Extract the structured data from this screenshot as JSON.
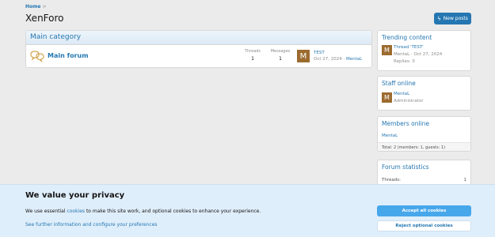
{
  "breadcrumb": {
    "home": "Home",
    "separator": ">"
  },
  "page": {
    "title": "XenForo",
    "new_posts_label": "New posts"
  },
  "category": {
    "title": "Main category"
  },
  "forum": {
    "name": "Main forum",
    "threads_label": "Threads",
    "threads_value": "1",
    "messages_label": "Messages",
    "messages_value": "1",
    "last_post": {
      "avatar_letter": "M",
      "title": "TEST",
      "date": "Oct 27, 2024",
      "meta_sep": "·",
      "user": "MentaL"
    }
  },
  "sidebar": {
    "trending": {
      "title": "Trending content",
      "avatar_letter": "M",
      "thread_title": "Thread 'TEST'",
      "meta": "MentaL · Oct 27, 2024",
      "replies": "Replies: 0"
    },
    "staff": {
      "title": "Staff online",
      "avatar_letter": "M",
      "user": "MentaL",
      "role": "Administrator"
    },
    "members": {
      "title": "Members online",
      "list": "MentaL",
      "total": "Total: 2 (members: 1, guests: 1)"
    },
    "stats": {
      "title": "Forum statistics",
      "threads_label": "Threads:",
      "threads_value": "1"
    }
  },
  "cookie": {
    "title": "We value your privacy",
    "body_before": "We use essential ",
    "body_link": "cookies",
    "body_after": " to make this site work, and optional cookies to enhance your experience.",
    "more_link": "See further information and configure your preferences",
    "accept": "Accept all cookies",
    "reject": "Reject optional cookies"
  },
  "colors": {
    "accent": "#2577b1",
    "accept_button": "#47a7eb",
    "banner": "#dfeefb"
  }
}
